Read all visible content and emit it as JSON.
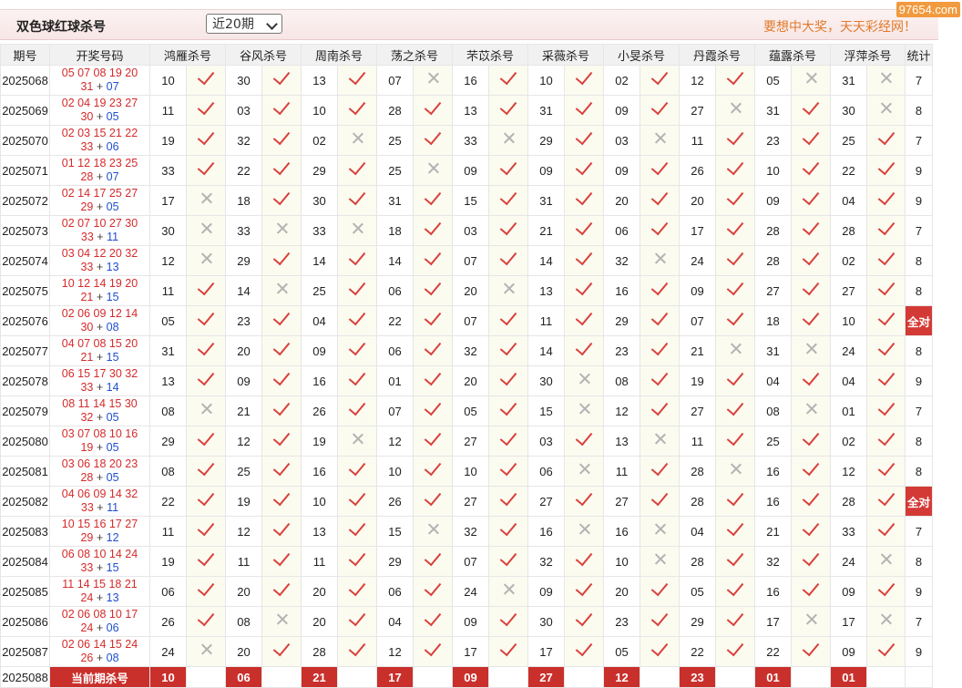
{
  "header": {
    "title": "双色球红球杀号",
    "period_select": "近20期",
    "slogan": "要想中大奖，天天彩经网！",
    "watermark": "97654.com"
  },
  "columns": {
    "period": "期号",
    "draw": "开奖号码",
    "experts": [
      "鸿雁杀号",
      "谷风杀号",
      "周南杀号",
      "荡之杀号",
      "芣苡杀号",
      "采薇杀号",
      "小旻杀号",
      "丹霞杀号",
      "蕴露杀号",
      "浮萍杀号"
    ],
    "stat": "统计"
  },
  "rows": [
    {
      "period": "2025068",
      "reds1": "05 07 08 19 20",
      "reds2": "31",
      "blue": "07",
      "kills": [
        "10",
        "30",
        "13",
        "07",
        "16",
        "10",
        "02",
        "12",
        "05",
        "31"
      ],
      "hits": [
        1,
        1,
        1,
        0,
        1,
        1,
        1,
        1,
        0,
        0
      ],
      "stat": "7"
    },
    {
      "period": "2025069",
      "reds1": "02 04 19 23 27",
      "reds2": "30",
      "blue": "05",
      "kills": [
        "11",
        "03",
        "10",
        "28",
        "13",
        "31",
        "09",
        "27",
        "31",
        "30"
      ],
      "hits": [
        1,
        1,
        1,
        1,
        1,
        1,
        1,
        0,
        1,
        0
      ],
      "stat": "8"
    },
    {
      "period": "2025070",
      "reds1": "02 03 15 21 22",
      "reds2": "33",
      "blue": "06",
      "kills": [
        "19",
        "32",
        "02",
        "25",
        "33",
        "29",
        "03",
        "11",
        "23",
        "25"
      ],
      "hits": [
        1,
        1,
        0,
        1,
        0,
        1,
        0,
        1,
        1,
        1
      ],
      "stat": "7"
    },
    {
      "period": "2025071",
      "reds1": "01 12 18 23 25",
      "reds2": "28",
      "blue": "07",
      "kills": [
        "33",
        "22",
        "29",
        "25",
        "09",
        "09",
        "09",
        "26",
        "10",
        "22"
      ],
      "hits": [
        1,
        1,
        1,
        0,
        1,
        1,
        1,
        1,
        1,
        1
      ],
      "stat": "9"
    },
    {
      "period": "2025072",
      "reds1": "02 14 17 25 27",
      "reds2": "29",
      "blue": "05",
      "kills": [
        "17",
        "18",
        "30",
        "31",
        "15",
        "31",
        "20",
        "20",
        "09",
        "04"
      ],
      "hits": [
        0,
        1,
        1,
        1,
        1,
        1,
        1,
        1,
        1,
        1
      ],
      "stat": "9"
    },
    {
      "period": "2025073",
      "reds1": "02 07 10 27 30",
      "reds2": "33",
      "blue": "11",
      "kills": [
        "30",
        "33",
        "33",
        "18",
        "03",
        "21",
        "06",
        "17",
        "28",
        "28"
      ],
      "hits": [
        0,
        0,
        0,
        1,
        1,
        1,
        1,
        1,
        1,
        1
      ],
      "stat": "7"
    },
    {
      "period": "2025074",
      "reds1": "03 04 12 20 32",
      "reds2": "33",
      "blue": "13",
      "kills": [
        "12",
        "29",
        "14",
        "14",
        "07",
        "14",
        "32",
        "24",
        "28",
        "02"
      ],
      "hits": [
        0,
        1,
        1,
        1,
        1,
        1,
        0,
        1,
        1,
        1
      ],
      "stat": "8"
    },
    {
      "period": "2025075",
      "reds1": "10 12 14 19 20",
      "reds2": "21",
      "blue": "15",
      "kills": [
        "11",
        "14",
        "25",
        "06",
        "20",
        "13",
        "16",
        "09",
        "27",
        "27"
      ],
      "hits": [
        1,
        0,
        1,
        1,
        0,
        1,
        1,
        1,
        1,
        1
      ],
      "stat": "8"
    },
    {
      "period": "2025076",
      "reds1": "02 06 09 12 14",
      "reds2": "30",
      "blue": "08",
      "kills": [
        "05",
        "23",
        "04",
        "22",
        "07",
        "11",
        "29",
        "07",
        "18",
        "10"
      ],
      "hits": [
        1,
        1,
        1,
        1,
        1,
        1,
        1,
        1,
        1,
        1
      ],
      "stat": "全对"
    },
    {
      "period": "2025077",
      "reds1": "04 07 08 15 20",
      "reds2": "21",
      "blue": "15",
      "kills": [
        "31",
        "20",
        "09",
        "06",
        "32",
        "14",
        "23",
        "21",
        "31",
        "24"
      ],
      "hits": [
        1,
        1,
        1,
        1,
        1,
        1,
        1,
        0,
        0,
        1
      ],
      "stat": "8"
    },
    {
      "period": "2025078",
      "reds1": "06 15 17 30 32",
      "reds2": "33",
      "blue": "14",
      "kills": [
        "13",
        "09",
        "16",
        "01",
        "20",
        "30",
        "08",
        "19",
        "04",
        "04"
      ],
      "hits": [
        1,
        1,
        1,
        1,
        1,
        0,
        1,
        1,
        1,
        1
      ],
      "stat": "9"
    },
    {
      "period": "2025079",
      "reds1": "08 11 14 15 30",
      "reds2": "32",
      "blue": "05",
      "kills": [
        "08",
        "21",
        "26",
        "07",
        "05",
        "15",
        "12",
        "27",
        "08",
        "01"
      ],
      "hits": [
        0,
        1,
        1,
        1,
        1,
        0,
        1,
        1,
        0,
        1
      ],
      "stat": "7"
    },
    {
      "period": "2025080",
      "reds1": "03 07 08 10 16",
      "reds2": "19",
      "blue": "05",
      "kills": [
        "29",
        "12",
        "19",
        "12",
        "27",
        "03",
        "13",
        "11",
        "25",
        "02"
      ],
      "hits": [
        1,
        1,
        0,
        1,
        1,
        1,
        0,
        1,
        1,
        1
      ],
      "stat": "8"
    },
    {
      "period": "2025081",
      "reds1": "03 06 18 20 23",
      "reds2": "28",
      "blue": "05",
      "kills": [
        "08",
        "25",
        "16",
        "10",
        "10",
        "06",
        "11",
        "28",
        "16",
        "12"
      ],
      "hits": [
        1,
        1,
        1,
        1,
        1,
        0,
        1,
        0,
        1,
        1
      ],
      "stat": "8"
    },
    {
      "period": "2025082",
      "reds1": "04 06 09 14 32",
      "reds2": "33",
      "blue": "11",
      "kills": [
        "22",
        "19",
        "10",
        "26",
        "27",
        "27",
        "27",
        "28",
        "16",
        "28"
      ],
      "hits": [
        1,
        1,
        1,
        1,
        1,
        1,
        1,
        1,
        1,
        1
      ],
      "stat": "全对"
    },
    {
      "period": "2025083",
      "reds1": "10 15 16 17 27",
      "reds2": "29",
      "blue": "12",
      "kills": [
        "11",
        "12",
        "13",
        "15",
        "32",
        "16",
        "16",
        "04",
        "21",
        "33"
      ],
      "hits": [
        1,
        1,
        1,
        0,
        1,
        0,
        0,
        1,
        1,
        1
      ],
      "stat": "7"
    },
    {
      "period": "2025084",
      "reds1": "06 08 10 14 24",
      "reds2": "33",
      "blue": "15",
      "kills": [
        "19",
        "11",
        "11",
        "29",
        "07",
        "32",
        "10",
        "28",
        "32",
        "24"
      ],
      "hits": [
        1,
        1,
        1,
        1,
        1,
        1,
        0,
        1,
        1,
        0
      ],
      "stat": "8"
    },
    {
      "period": "2025085",
      "reds1": "11 14 15 18 21",
      "reds2": "24",
      "blue": "13",
      "kills": [
        "06",
        "20",
        "20",
        "06",
        "24",
        "09",
        "20",
        "05",
        "16",
        "09"
      ],
      "hits": [
        1,
        1,
        1,
        1,
        0,
        1,
        1,
        1,
        1,
        1
      ],
      "stat": "9"
    },
    {
      "period": "2025086",
      "reds1": "02 06 08 10 17",
      "reds2": "24",
      "blue": "06",
      "kills": [
        "26",
        "08",
        "20",
        "04",
        "09",
        "30",
        "23",
        "29",
        "17",
        "17"
      ],
      "hits": [
        1,
        0,
        1,
        1,
        1,
        1,
        1,
        1,
        0,
        0
      ],
      "stat": "7"
    },
    {
      "period": "2025087",
      "reds1": "02 06 14 15 24",
      "reds2": "26",
      "blue": "08",
      "kills": [
        "24",
        "20",
        "28",
        "12",
        "17",
        "17",
        "05",
        "22",
        "22",
        "09"
      ],
      "hits": [
        0,
        1,
        1,
        1,
        1,
        1,
        1,
        1,
        1,
        1
      ],
      "stat": "9"
    }
  ],
  "current": {
    "period": "2025088",
    "label": "当前期杀号",
    "kills": [
      "10",
      "06",
      "21",
      "17",
      "09",
      "27",
      "12",
      "23",
      "01",
      "01"
    ]
  },
  "icons": {
    "hit": "check-icon",
    "miss": "cross-icon"
  },
  "colors": {
    "red_ball": "#d52a2a",
    "blue_ball": "#1e4fd0",
    "accent": "#c9302c",
    "slogan": "#e07a2c"
  }
}
